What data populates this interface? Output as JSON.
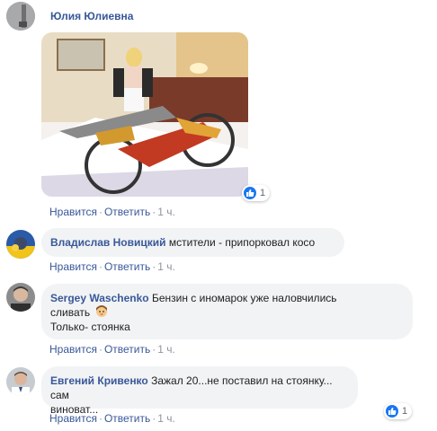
{
  "comments": [
    {
      "author": "Юлия Юлиевна",
      "actions": {
        "like": "Нравится",
        "reply": "Ответить",
        "time": "1 ч."
      },
      "reactions": "1"
    },
    {
      "author": "Владислав Новицкий",
      "text": "мстители - припорковал косо",
      "actions": {
        "like": "Нравится",
        "reply": "Ответить",
        "time": "1 ч."
      }
    },
    {
      "author": "Sergey Waschenko",
      "text_line1": "Бензин с иномарок уже наловчились",
      "text_line2": "сливать",
      "text_line3": "Только- стоянка",
      "actions": {
        "like": "Нравится",
        "reply": "Ответить",
        "time": "1 ч."
      }
    },
    {
      "author": "Евгений Кривенко",
      "text_line1": "Зажал 20...не поставил на стоянку... сам",
      "text_line2": "виноват...",
      "actions": {
        "like": "Нравится",
        "reply": "Ответить",
        "time": "1 ч."
      },
      "reactions": "1"
    }
  ],
  "separator": "·",
  "colors": {
    "link": "#385898",
    "bubble": "#f2f3f5",
    "like": "#1877f2"
  }
}
